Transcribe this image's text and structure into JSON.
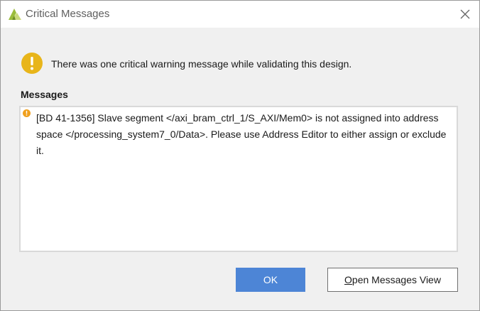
{
  "window": {
    "title": "Critical Messages",
    "app_icon": "vivado-logo-icon",
    "close_icon": "close-icon"
  },
  "summary": {
    "icon": "warning-icon",
    "text": "There was one critical warning message while validating this design."
  },
  "messages": {
    "label": "Messages",
    "items": [
      {
        "severity_icon": "critical-warning-icon",
        "text": "[BD 41-1356] Slave segment </axi_bram_ctrl_1/S_AXI/Mem0> is not assigned into address space </processing_system7_0/Data>. Please use Address Editor to either assign or exclude it."
      }
    ]
  },
  "buttons": {
    "ok_label": "OK",
    "open_mnemonic": "O",
    "open_rest": "pen Messages View"
  },
  "colors": {
    "accent": "#4d85d6",
    "warning": "#e8b51a",
    "logo_green": "#9bbd3c"
  }
}
